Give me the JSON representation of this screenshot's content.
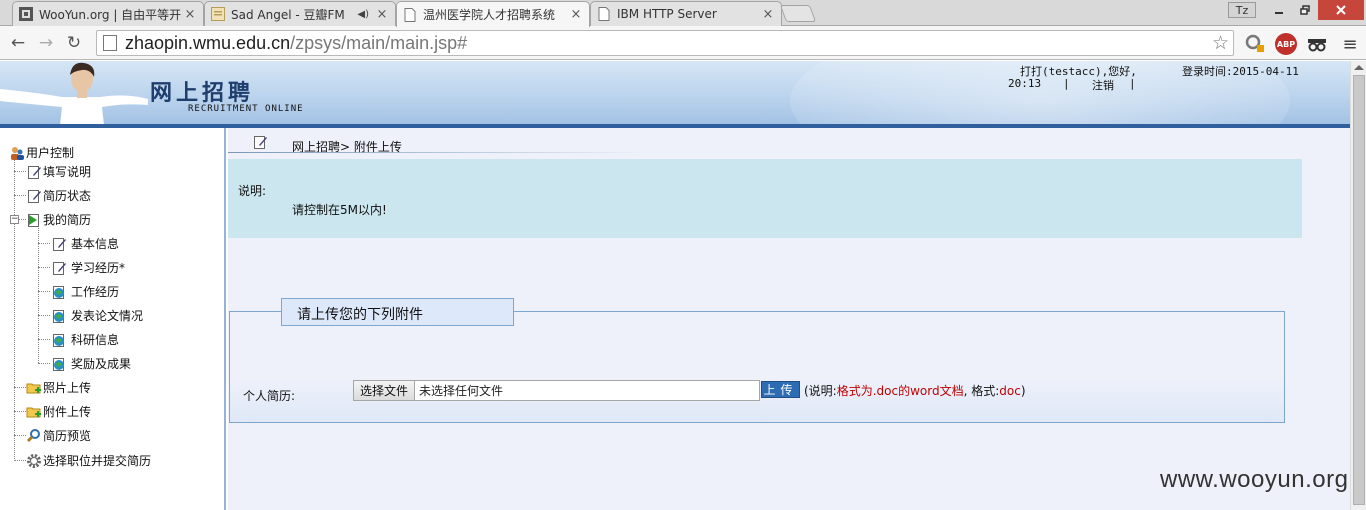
{
  "browser": {
    "tabs": [
      {
        "title": "WooYun.org | 自由平等开",
        "active": false,
        "audio": false
      },
      {
        "title": "Sad Angel - 豆瓣FM",
        "active": false,
        "audio": true
      },
      {
        "title": "温州医学院人才招聘系统",
        "active": true,
        "audio": false
      },
      {
        "title": "IBM HTTP Server",
        "active": false,
        "audio": false
      }
    ],
    "tab_close": "×",
    "user_badge": "Tz",
    "url_host": "zhaopin.wmu.edu.cn",
    "url_path": "/zpsys/main/main.jsp#",
    "ext_abp": "ABP",
    "menu_glyph": "≡",
    "back_glyph": "←",
    "forward_glyph": "→",
    "reload_glyph": "↻",
    "star_glyph": "☆"
  },
  "header": {
    "title": "网上招聘",
    "subtitle": "RECRUITMENT ONLINE",
    "greeting": "打打(testacc),您好,",
    "login_time_label": "登录时间:2015-04-11",
    "login_time_clock": "20:13",
    "separator": "|",
    "logout": "注销"
  },
  "sidebar": {
    "root": "用户控制",
    "items": [
      {
        "label": "填写说明",
        "icon": "edit-doc-icon"
      },
      {
        "label": "简历状态",
        "icon": "edit-doc-icon"
      },
      {
        "label": "我的简历",
        "icon": "green-arrow-doc-icon"
      },
      {
        "label": "基本信息",
        "icon": "edit-doc-icon"
      },
      {
        "label": "学习经历*",
        "icon": "edit-doc-icon"
      },
      {
        "label": "工作经历",
        "icon": "globe-doc-icon"
      },
      {
        "label": "发表论文情况",
        "icon": "globe-doc-icon"
      },
      {
        "label": "科研信息",
        "icon": "globe-doc-icon"
      },
      {
        "label": "奖励及成果",
        "icon": "globe-doc-icon"
      },
      {
        "label": "照片上传",
        "icon": "folder-add-icon"
      },
      {
        "label": "附件上传",
        "icon": "folder-add-icon"
      },
      {
        "label": "简历预览",
        "icon": "magnifier-icon"
      },
      {
        "label": "选择职位并提交简历",
        "icon": "gear-icon"
      }
    ],
    "expander": "−"
  },
  "main": {
    "breadcrumb": "网上招聘> 附件上传",
    "notice_label": "说明:",
    "notice_text": "请控制在5M以内!",
    "section_title": "请上传您的下列附件",
    "resume_label": "个人简历:",
    "file_button": "选择文件",
    "file_placeholder": "未选择任何文件",
    "upload_button": "上传",
    "hint_prefix": "(说明:",
    "hint_red": "格式为.doc的word文档",
    "hint_mid": ", 格式:",
    "hint_format": "doc",
    "hint_suffix": ")"
  },
  "watermark": "www.wooyun.org",
  "colors": {
    "banner_bar": "#2f5f9c",
    "notice_bg": "#cbe6ef",
    "hint_red": "#c00000",
    "upload_btn": "#2d6cb3"
  }
}
